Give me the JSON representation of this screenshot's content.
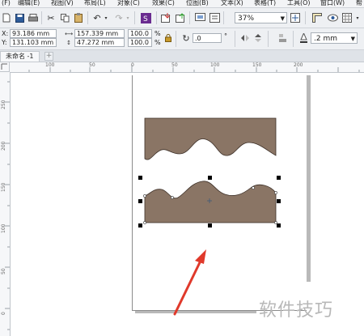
{
  "menubar": {
    "items": [
      "(F)",
      "编辑(E)",
      "视图(V)",
      "布局(L)",
      "对象(C)",
      "效果(C)",
      "位图(B)",
      "文本(X)",
      "表格(T)",
      "工具(O)",
      "窗口(W)",
      "帮"
    ]
  },
  "toolbar": {
    "zoom": "37%"
  },
  "propertybar": {
    "x_label": "X:",
    "x_value": "93.186 mm",
    "y_label": "Y:",
    "y_value": "131.103 mm",
    "width_value": "157.339 mm",
    "height_value": "47.272 mm",
    "scale_w": "100.0",
    "scale_h": "100.0",
    "percent": "%",
    "rotation": ".0",
    "degree": "°",
    "outline_width": ".2 mm"
  },
  "tabs": {
    "document": "未命名 -1",
    "add": "+"
  },
  "ruler": {
    "unit_corner": "毫米",
    "h_marks": [
      "100",
      "50",
      "0",
      "50",
      "100",
      "150",
      "200"
    ],
    "v_marks": [
      "250",
      "200",
      "150",
      "100",
      "50",
      "0"
    ]
  },
  "colors": {
    "shape_fill": "#8a7565",
    "arrow": "#e0392b"
  },
  "watermark": "软件技巧"
}
